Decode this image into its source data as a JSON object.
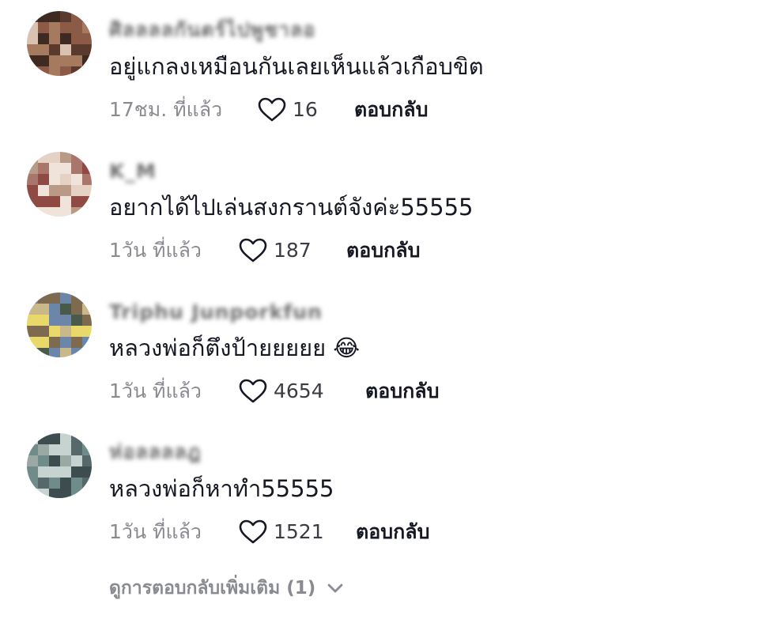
{
  "comments": [
    {
      "username": "ศิลลลลกันตร์ไปพูชาลอ",
      "text": "อยู่แกลงเหมือนกันเลยเห็นแล้วเกือบขิต",
      "time": "17ชม. ที่แล้ว",
      "likes": "16",
      "reply_label": "ตอบกลับ",
      "avatar_colors": [
        "#5b3a2e",
        "#a57a5f",
        "#d9c2b0",
        "#3f2a22",
        "#8c5b47"
      ]
    },
    {
      "username": "K_M",
      "text": "อยากได้ไปเล่นสงกรานต์จังค่ะ55555",
      "time": "1วัน ที่แล้ว",
      "likes": "187",
      "reply_label": "ตอบกลับ",
      "avatar_colors": [
        "#b89a86",
        "#e6d2c4",
        "#8e4a43",
        "#f0e4da",
        "#a8766a"
      ]
    },
    {
      "username": "Triphu Junporkfun",
      "text": "หลวงพ่อก็ตึงป้ายยยยย 😂",
      "time": "1วัน ที่แล้ว",
      "likes": "4654",
      "reply_label": "ตอบกลับ",
      "avatar_colors": [
        "#6b86a8",
        "#e9d96a",
        "#4a5a4a",
        "#c9b88a",
        "#7d6a4f"
      ]
    },
    {
      "username": "ห่อลลลลฎ",
      "text": "หลวงพ่อก็หาทำ55555",
      "time": "1วัน ที่แล้ว",
      "likes": "1521",
      "reply_label": "ตอบกลับ",
      "avatar_colors": [
        "#6f8c8a",
        "#c7d3d0",
        "#3d4d4f",
        "#9aa9a4",
        "#56686a"
      ]
    }
  ],
  "view_more": {
    "label": "ดูการตอบกลับเพิ่มเติม (1)",
    "icon": "chevron-down-icon"
  },
  "icons": {
    "like": "heart-outline-icon"
  }
}
